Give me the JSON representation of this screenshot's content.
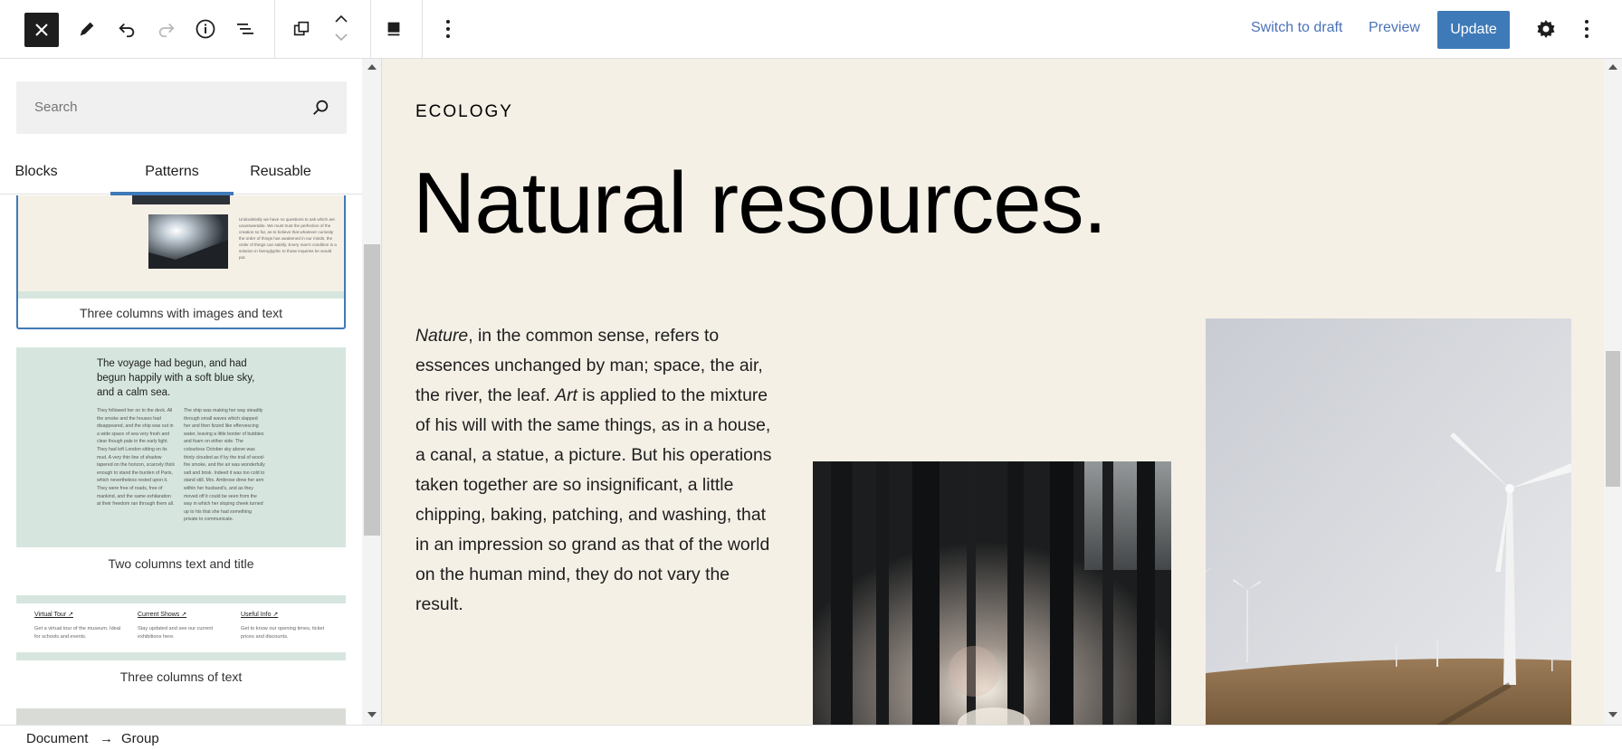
{
  "toolbar": {
    "switch_to_draft": "Switch to draft",
    "preview": "Preview",
    "update": "Update"
  },
  "sidebar": {
    "search_placeholder": "Search",
    "tabs": [
      "Blocks",
      "Patterns",
      "Reusable"
    ],
    "active_tab": "Patterns",
    "patterns": [
      {
        "label": "Three columns with images and text",
        "preview_text": "Undoubtedly we have no questions to ask which are unanswerable. We must trust the perfection of the creation so far, as to believe that whatever curiosity the order of things has awakened in our minds, the order of things can satisfy. Every man's condition is a solution in hieroglyphic to those inquiries he would put."
      },
      {
        "label": "Two columns text and title",
        "preview_title": "The voyage had begun, and had begun happily with a soft blue sky, and a calm sea.",
        "preview_col1": "They followed her on to the deck. All the smoke and the houses had disappeared, and the ship was out in a wide space of sea very fresh and clear though pale in the early light. They had left London sitting on its mud. A very thin line of shadow tapered on the horizon, scarcely thick enough to stand the burden of Paris, which nevertheless rested upon it. They were free of roads, free of mankind, and the same exhilaration at their freedom ran through them all.",
        "preview_col2": "The ship was making her way steadily through small waves which slapped her and then fizzed like effervescing water, leaving a little border of bubbles and foam on either side. The colourless October sky above was thinly clouded as if by the trail of wood-fire smoke, and the air was wonderfully salt and brisk. Indeed it was too cold to stand still. Mrs. Ambrose drew her arm within her husband's, and as they moved off it could be seen from the way in which her sloping cheek turned up to his that she had something private to communicate."
      },
      {
        "label": "Three columns of text",
        "columns": [
          {
            "title": "Virtual Tour ↗",
            "text": "Get a virtual tour of the museum. Ideal for schools and events."
          },
          {
            "title": "Current Shows ↗",
            "text": "Stay updated and see our current exhibitions here."
          },
          {
            "title": "Useful Info ↗",
            "text": "Get to know our opening times, ticket prices and discounts."
          }
        ]
      }
    ]
  },
  "canvas": {
    "eyebrow": "ECOLOGY",
    "headline": "Natural resources.",
    "body_parts": {
      "nature": "Nature",
      "p1": ", in the common sense, refers to essences unchanged by man; space, the air, the river, the leaf. ",
      "art": "Art",
      "p2": " is applied to the mixture of his will with the same things, as in a house, a canal, a statue, a picture. But his operations taken together are so insignificant, a little chipping, baking, patching, and washing, that in an impression so grand as that of the world on the human mind, they do not vary the result."
    }
  },
  "breadcrumb": {
    "items": [
      "Document",
      "Group"
    ],
    "separator": "→"
  },
  "colors": {
    "accent": "#3f7ab8",
    "canvas_bg": "#f5f0e6",
    "pattern_bg_beige": "#f5f0e6",
    "pattern_bg_mint": "#d6e6de"
  }
}
